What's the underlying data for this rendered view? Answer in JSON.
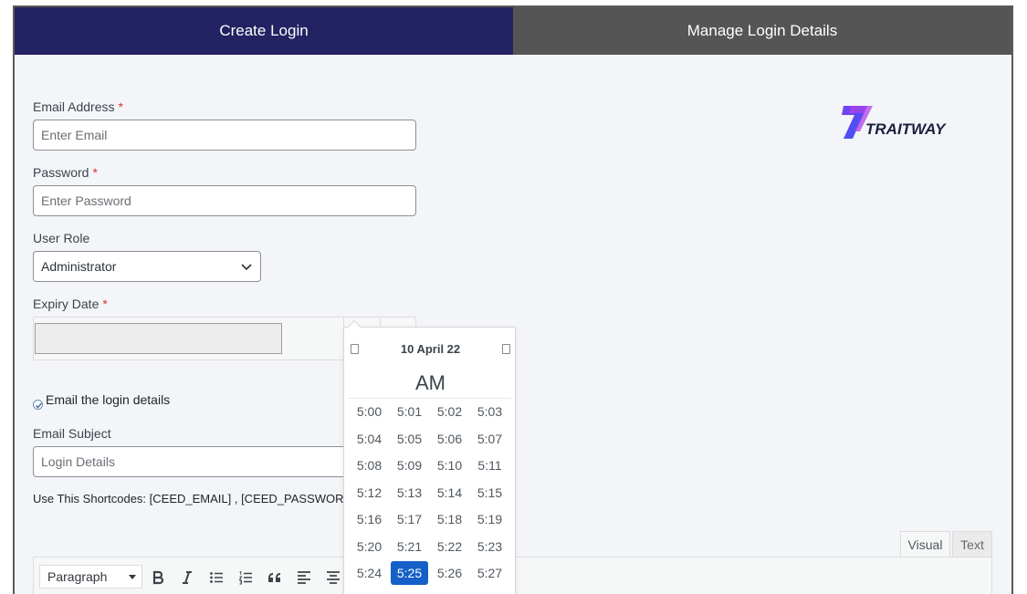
{
  "tabs": [
    {
      "label": "Create Login",
      "active": true
    },
    {
      "label": "Manage Login Details",
      "active": false
    }
  ],
  "form": {
    "email_label": "Email Address",
    "email_placeholder": "Enter Email",
    "password_label": "Password",
    "password_placeholder": "Enter Password",
    "role_label": "User Role",
    "role_value": "Administrator",
    "expiry_label": "Expiry Date",
    "required_mark": "*",
    "email_login_label": "Email the login details",
    "email_login_checked": true,
    "subject_label": "Email Subject",
    "subject_placeholder": "Login Details",
    "shortcodes_text": "Use This Shortcodes: [CEED_EMAIL] , [CEED_PASSWOR"
  },
  "logo": {
    "text": "TRAITWAY",
    "mark": "7"
  },
  "editor": {
    "visual_tab": "Visual",
    "text_tab": "Text",
    "paragraph_value": "Paragraph",
    "buttons": [
      "bold-icon",
      "italic-icon",
      "bullet-list-icon",
      "numbered-list-icon",
      "blockquote-icon",
      "align-left-icon",
      "align-center-icon"
    ]
  },
  "picker": {
    "date": "10 April 22",
    "ampm": "AM",
    "times": [
      "5:00",
      "5:01",
      "5:02",
      "5:03",
      "5:04",
      "5:05",
      "5:06",
      "5:07",
      "5:08",
      "5:09",
      "5:10",
      "5:11",
      "5:12",
      "5:13",
      "5:14",
      "5:15",
      "5:16",
      "5:17",
      "5:18",
      "5:19",
      "5:20",
      "5:21",
      "5:22",
      "5:23",
      "5:24",
      "5:25",
      "5:26",
      "5:27"
    ],
    "selected": "5:25"
  },
  "colors": {
    "active_tab": "#232262",
    "inactive_tab": "#555555",
    "selected_time": "#1560c8"
  }
}
